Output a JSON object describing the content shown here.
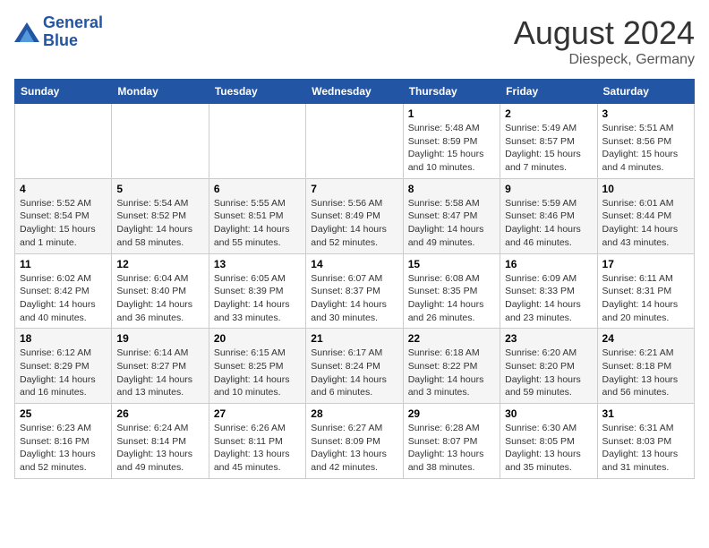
{
  "header": {
    "logo": {
      "line1": "General",
      "line2": "Blue"
    },
    "title": "August 2024",
    "location": "Diespeck, Germany"
  },
  "weekdays": [
    "Sunday",
    "Monday",
    "Tuesday",
    "Wednesday",
    "Thursday",
    "Friday",
    "Saturday"
  ],
  "weeks": [
    [
      {
        "day": "",
        "sunrise": "",
        "sunset": "",
        "daylight": ""
      },
      {
        "day": "",
        "sunrise": "",
        "sunset": "",
        "daylight": ""
      },
      {
        "day": "",
        "sunrise": "",
        "sunset": "",
        "daylight": ""
      },
      {
        "day": "",
        "sunrise": "",
        "sunset": "",
        "daylight": ""
      },
      {
        "day": "1",
        "sunrise": "5:48 AM",
        "sunset": "8:59 PM",
        "daylight": "15 hours and 10 minutes."
      },
      {
        "day": "2",
        "sunrise": "5:49 AM",
        "sunset": "8:57 PM",
        "daylight": "15 hours and 7 minutes."
      },
      {
        "day": "3",
        "sunrise": "5:51 AM",
        "sunset": "8:56 PM",
        "daylight": "15 hours and 4 minutes."
      }
    ],
    [
      {
        "day": "4",
        "sunrise": "5:52 AM",
        "sunset": "8:54 PM",
        "daylight": "15 hours and 1 minute."
      },
      {
        "day": "5",
        "sunrise": "5:54 AM",
        "sunset": "8:52 PM",
        "daylight": "14 hours and 58 minutes."
      },
      {
        "day": "6",
        "sunrise": "5:55 AM",
        "sunset": "8:51 PM",
        "daylight": "14 hours and 55 minutes."
      },
      {
        "day": "7",
        "sunrise": "5:56 AM",
        "sunset": "8:49 PM",
        "daylight": "14 hours and 52 minutes."
      },
      {
        "day": "8",
        "sunrise": "5:58 AM",
        "sunset": "8:47 PM",
        "daylight": "14 hours and 49 minutes."
      },
      {
        "day": "9",
        "sunrise": "5:59 AM",
        "sunset": "8:46 PM",
        "daylight": "14 hours and 46 minutes."
      },
      {
        "day": "10",
        "sunrise": "6:01 AM",
        "sunset": "8:44 PM",
        "daylight": "14 hours and 43 minutes."
      }
    ],
    [
      {
        "day": "11",
        "sunrise": "6:02 AM",
        "sunset": "8:42 PM",
        "daylight": "14 hours and 40 minutes."
      },
      {
        "day": "12",
        "sunrise": "6:04 AM",
        "sunset": "8:40 PM",
        "daylight": "14 hours and 36 minutes."
      },
      {
        "day": "13",
        "sunrise": "6:05 AM",
        "sunset": "8:39 PM",
        "daylight": "14 hours and 33 minutes."
      },
      {
        "day": "14",
        "sunrise": "6:07 AM",
        "sunset": "8:37 PM",
        "daylight": "14 hours and 30 minutes."
      },
      {
        "day": "15",
        "sunrise": "6:08 AM",
        "sunset": "8:35 PM",
        "daylight": "14 hours and 26 minutes."
      },
      {
        "day": "16",
        "sunrise": "6:09 AM",
        "sunset": "8:33 PM",
        "daylight": "14 hours and 23 minutes."
      },
      {
        "day": "17",
        "sunrise": "6:11 AM",
        "sunset": "8:31 PM",
        "daylight": "14 hours and 20 minutes."
      }
    ],
    [
      {
        "day": "18",
        "sunrise": "6:12 AM",
        "sunset": "8:29 PM",
        "daylight": "14 hours and 16 minutes."
      },
      {
        "day": "19",
        "sunrise": "6:14 AM",
        "sunset": "8:27 PM",
        "daylight": "14 hours and 13 minutes."
      },
      {
        "day": "20",
        "sunrise": "6:15 AM",
        "sunset": "8:25 PM",
        "daylight": "14 hours and 10 minutes."
      },
      {
        "day": "21",
        "sunrise": "6:17 AM",
        "sunset": "8:24 PM",
        "daylight": "14 hours and 6 minutes."
      },
      {
        "day": "22",
        "sunrise": "6:18 AM",
        "sunset": "8:22 PM",
        "daylight": "14 hours and 3 minutes."
      },
      {
        "day": "23",
        "sunrise": "6:20 AM",
        "sunset": "8:20 PM",
        "daylight": "13 hours and 59 minutes."
      },
      {
        "day": "24",
        "sunrise": "6:21 AM",
        "sunset": "8:18 PM",
        "daylight": "13 hours and 56 minutes."
      }
    ],
    [
      {
        "day": "25",
        "sunrise": "6:23 AM",
        "sunset": "8:16 PM",
        "daylight": "13 hours and 52 minutes."
      },
      {
        "day": "26",
        "sunrise": "6:24 AM",
        "sunset": "8:14 PM",
        "daylight": "13 hours and 49 minutes."
      },
      {
        "day": "27",
        "sunrise": "6:26 AM",
        "sunset": "8:11 PM",
        "daylight": "13 hours and 45 minutes."
      },
      {
        "day": "28",
        "sunrise": "6:27 AM",
        "sunset": "8:09 PM",
        "daylight": "13 hours and 42 minutes."
      },
      {
        "day": "29",
        "sunrise": "6:28 AM",
        "sunset": "8:07 PM",
        "daylight": "13 hours and 38 minutes."
      },
      {
        "day": "30",
        "sunrise": "6:30 AM",
        "sunset": "8:05 PM",
        "daylight": "13 hours and 35 minutes."
      },
      {
        "day": "31",
        "sunrise": "6:31 AM",
        "sunset": "8:03 PM",
        "daylight": "13 hours and 31 minutes."
      }
    ]
  ],
  "labels": {
    "sunrise": "Sunrise:",
    "sunset": "Sunset:",
    "daylight": "Daylight:"
  }
}
